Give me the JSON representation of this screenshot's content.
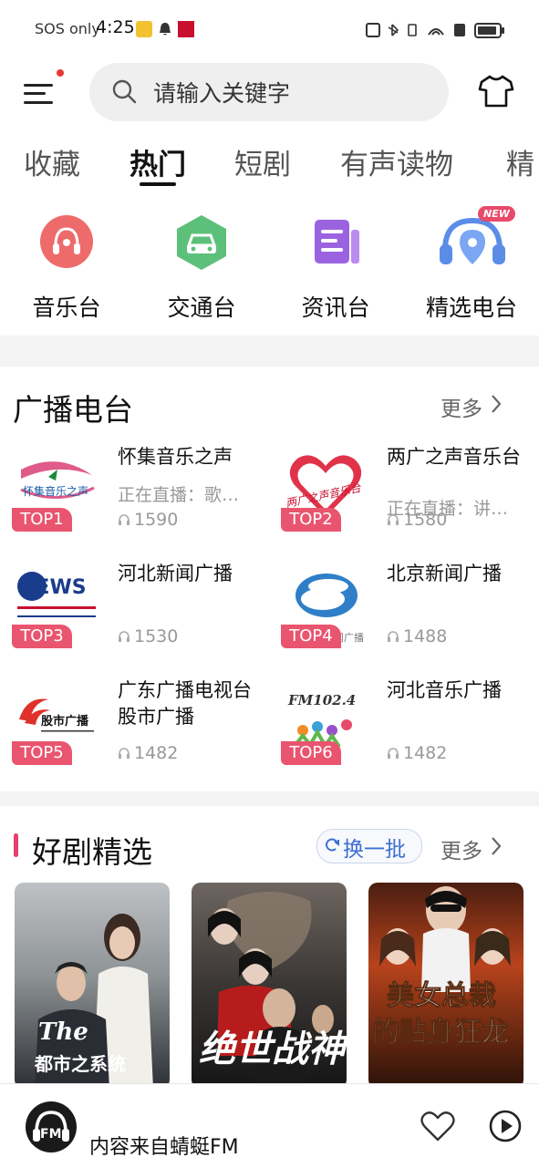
{
  "status_bar": {
    "sos": "SOS only",
    "time": "4:25"
  },
  "search": {
    "placeholder": "请输入关键字"
  },
  "tabs": [
    "收藏",
    "热门",
    "短剧",
    "有声读物",
    "精"
  ],
  "categories": [
    {
      "label": "音乐台",
      "icon": "music-radio-icon"
    },
    {
      "label": "交通台",
      "icon": "car-icon"
    },
    {
      "label": "资讯台",
      "icon": "news-icon"
    },
    {
      "label": "精选电台",
      "icon": "headphones-location-icon",
      "badge": "NEW"
    }
  ],
  "radio": {
    "title": "广播电台",
    "more": "更多",
    "stations": [
      {
        "rank": "TOP1",
        "name": "怀集音乐之声",
        "subtitle": "正在直播：歌…",
        "listeners": "1590",
        "logo_text": "怀集音乐之声"
      },
      {
        "rank": "TOP2",
        "name": "两广之声音乐台",
        "subtitle": "正在直播：讲…",
        "listeners": "1580",
        "logo_text": "两广之声音乐台"
      },
      {
        "rank": "TOP3",
        "name": "河北新闻广播",
        "subtitle": "",
        "listeners": "1530",
        "logo_text": "NEWS"
      },
      {
        "rank": "TOP4",
        "name": "北京新闻广播",
        "subtitle": "",
        "listeners": "1488",
        "logo_text": "闻广播"
      },
      {
        "rank": "TOP5",
        "name": "广东广播电视台股市广播",
        "subtitle": "",
        "listeners": "1482",
        "logo_text": "股市广播"
      },
      {
        "rank": "TOP6",
        "name": "河北音乐广播",
        "subtitle": "",
        "listeners": "1482",
        "logo_text": "FM102.4"
      }
    ]
  },
  "drama": {
    "title": "好剧精选",
    "swap": "换一批",
    "more": "更多",
    "posters": [
      {
        "title": "都市之系统"
      },
      {
        "title": "绝世战神"
      },
      {
        "title": "美女总裁的贴身狂龙"
      }
    ]
  },
  "player": {
    "text": "内容来自蜻蜓FM",
    "logo": "FM"
  },
  "colors": {
    "accent_pink": "#e9556f",
    "swap_blue": "#3c6fd1"
  }
}
